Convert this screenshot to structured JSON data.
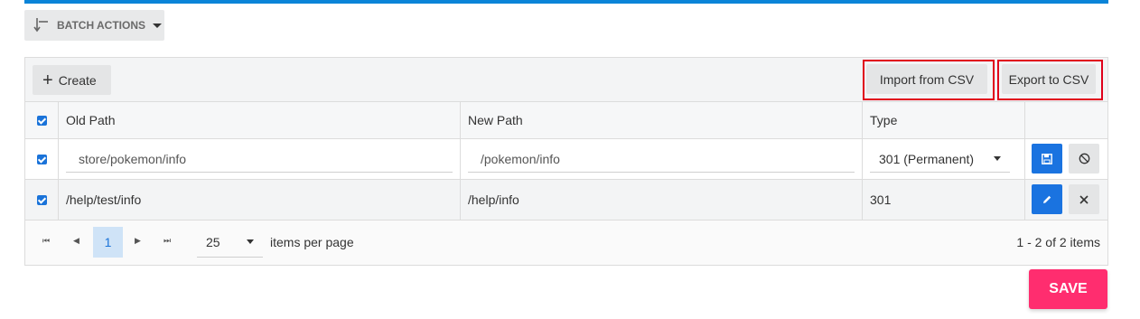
{
  "colors": {
    "accent_bar": "#0a84d8",
    "primary_blue": "#1a73e0",
    "highlight_red": "#e0001b",
    "save_pink": "#ff2d6f"
  },
  "batch": {
    "label": "BATCH ACTIONS",
    "icon": "batch-arrow-icon"
  },
  "toolbar": {
    "create_label": "Create",
    "import_label": "Import from CSV",
    "export_label": "Export to CSV"
  },
  "table": {
    "headers": {
      "old_path": "Old Path",
      "new_path": "New Path",
      "type": "Type"
    },
    "edit_row": {
      "old_path": "store/pokemon/info",
      "new_path": "/pokemon/info",
      "type": "301 (Permanent)"
    },
    "view_row": {
      "old_path": "/help/test/info",
      "new_path": "/help/info",
      "type": "301"
    }
  },
  "pager": {
    "current_page": "1",
    "per_page": "25",
    "per_page_label": "items per page",
    "info": "1 - 2 of 2 items"
  },
  "save_label": "SAVE"
}
